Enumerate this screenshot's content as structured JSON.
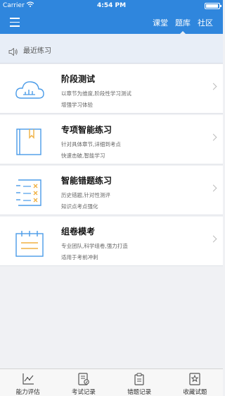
{
  "status_bar": {
    "carrier": "Carrier",
    "time": "4:54 PM"
  },
  "nav": {
    "menu_icon": "hamburger-menu-icon",
    "tabs": [
      {
        "label": "课堂"
      },
      {
        "label": "题库",
        "active": true
      },
      {
        "label": "社区"
      }
    ]
  },
  "recent": {
    "icon": "speaker-icon",
    "label": "最近练习"
  },
  "cards": [
    {
      "title": "阶段测试",
      "line1": "以章节为维度,阶段性学习测试",
      "line2": "增强学习体验",
      "icon": "cloud-chart-icon"
    },
    {
      "title": "专项智能练习",
      "line1": "针对具体章节,详细到考点",
      "line2": "快速击破,智能学习",
      "icon": "book-icon"
    },
    {
      "title": "智能错题练习",
      "line1": "历史错题,针对性测评",
      "line2": "知识点考点强化",
      "icon": "checklist-icon"
    },
    {
      "title": "组卷模考",
      "line1": "专业团队,科学组卷,强力打造",
      "line2": "适用于考前冲刺",
      "icon": "notepad-icon"
    }
  ],
  "tab_bar": [
    {
      "label": "能力评估",
      "icon": "chart-icon"
    },
    {
      "label": "考试记录",
      "icon": "document-edit-icon"
    },
    {
      "label": "错题记录",
      "icon": "clipboard-icon"
    },
    {
      "label": "收藏试题",
      "icon": "star-bookmark-icon"
    }
  ],
  "colors": {
    "primary": "#2f86dd",
    "card_icon": "#4a9be8",
    "card_icon_accent": "#f0b042"
  }
}
